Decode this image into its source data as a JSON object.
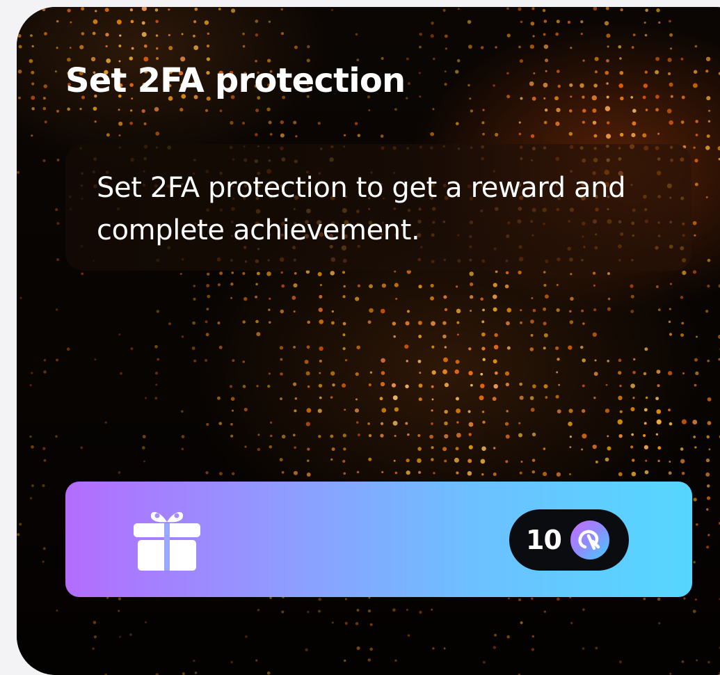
{
  "card": {
    "title": "Set 2FA protection",
    "description": "Set 2FA protection to get a reward and complete achievement."
  },
  "reward": {
    "icon": "gift-icon",
    "amount": "10",
    "currency_icon": "coin-icon",
    "gradient_start": "#b46cfd",
    "gradient_end": "#55d7ff"
  },
  "colors": {
    "card_background": "#050302",
    "dot_accent": "#ff9a2a",
    "pill_background": "#0b0c10"
  }
}
